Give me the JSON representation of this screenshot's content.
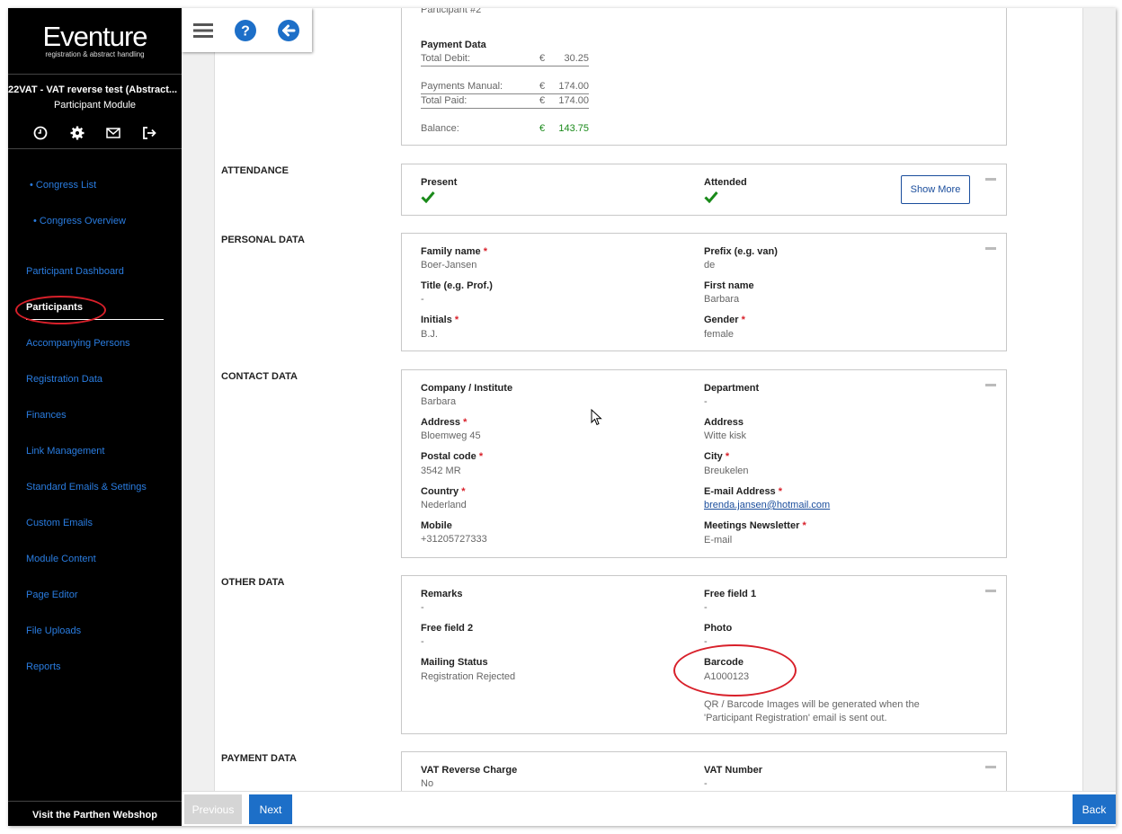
{
  "sidebar": {
    "logo_main": "Eventure",
    "logo_sub": "registration & abstract handling",
    "congress_title": "22VAT - VAT reverse test (Abstract...",
    "module_title": "Participant Module",
    "icons": [
      "clock-icon",
      "gear-icon",
      "mail-icon",
      "logout-icon"
    ],
    "sub_links": [
      "• Congress List",
      "• Congress Overview"
    ],
    "nav": [
      "Participant Dashboard",
      "Participants",
      "Accompanying Persons",
      "Registration Data",
      "Finances",
      "Link Management",
      "Standard Emails & Settings",
      "Custom Emails",
      "Module Content",
      "Page Editor",
      "File Uploads",
      "Reports"
    ],
    "webshop": "Visit the Parthen Webshop"
  },
  "toolbar": {
    "icons": [
      "menu-icon",
      "help-icon",
      "back-arrow-icon"
    ]
  },
  "payment_summary": {
    "participant": "Participant #2",
    "heading": "Payment Data",
    "rows": [
      {
        "label": "Total Debit:",
        "currency": "€",
        "amount": "30.25"
      },
      {
        "label": "Payments Manual:",
        "currency": "€",
        "amount": "174.00"
      },
      {
        "label": "Total Paid:",
        "currency": "€",
        "amount": "174.00"
      },
      {
        "label": "Balance:",
        "currency": "€",
        "amount": "143.75"
      }
    ]
  },
  "attendance": {
    "section": "ATTENDANCE",
    "present_label": "Present",
    "attended_label": "Attended",
    "show_more": "Show More"
  },
  "personal": {
    "section": "PERSONAL DATA",
    "family_name_label": "Family name",
    "family_name": "Boer-Jansen",
    "prefix_label": "Prefix (e.g. van)",
    "prefix": "de",
    "title_label": "Title (e.g. Prof.)",
    "title": "-",
    "first_name_label": "First name",
    "first_name": "Barbara",
    "initials_label": "Initials",
    "initials": "B.J.",
    "gender_label": "Gender",
    "gender": "female"
  },
  "contact": {
    "section": "CONTACT DATA",
    "company_label": "Company / Institute",
    "company": "Barbara",
    "department_label": "Department",
    "department": "-",
    "address_label": "Address",
    "address": "Bloemweg 45",
    "address2_label": "Address",
    "address2": "Witte kisk",
    "postal_label": "Postal code",
    "postal": "3542 MR",
    "city_label": "City",
    "city": "Breukelen",
    "country_label": "Country",
    "country": "Nederland",
    "email_label": "E-mail Address",
    "email": "brenda.jansen@hotmail.com",
    "mobile_label": "Mobile",
    "mobile": "+31205727333",
    "newsletter_label": "Meetings Newsletter",
    "newsletter": "E-mail"
  },
  "other": {
    "section": "OTHER DATA",
    "remarks_label": "Remarks",
    "remarks": "-",
    "free1_label": "Free field 1",
    "free1": "-",
    "free2_label": "Free field 2",
    "free2": "-",
    "photo_label": "Photo",
    "photo": "-",
    "mailing_label": "Mailing Status",
    "mailing": "Registration Rejected",
    "barcode_label": "Barcode",
    "barcode": "A1000123",
    "note_line1": "QR / Barcode Images will be generated when the",
    "note_line2": "'Participant Registration' email is sent out."
  },
  "payment": {
    "section": "PAYMENT DATA",
    "vat_reverse_label": "VAT Reverse Charge",
    "vat_reverse": "No",
    "vat_number_label": "VAT Number",
    "vat_number": "-"
  },
  "footer": {
    "previous": "Previous",
    "next": "Next",
    "back": "Back"
  },
  "colors": {
    "accent": "#1d6fc8",
    "link": "#2a7de1",
    "required": "#d8202a",
    "success": "#1a8a1a",
    "annotation": "#d8202a"
  }
}
